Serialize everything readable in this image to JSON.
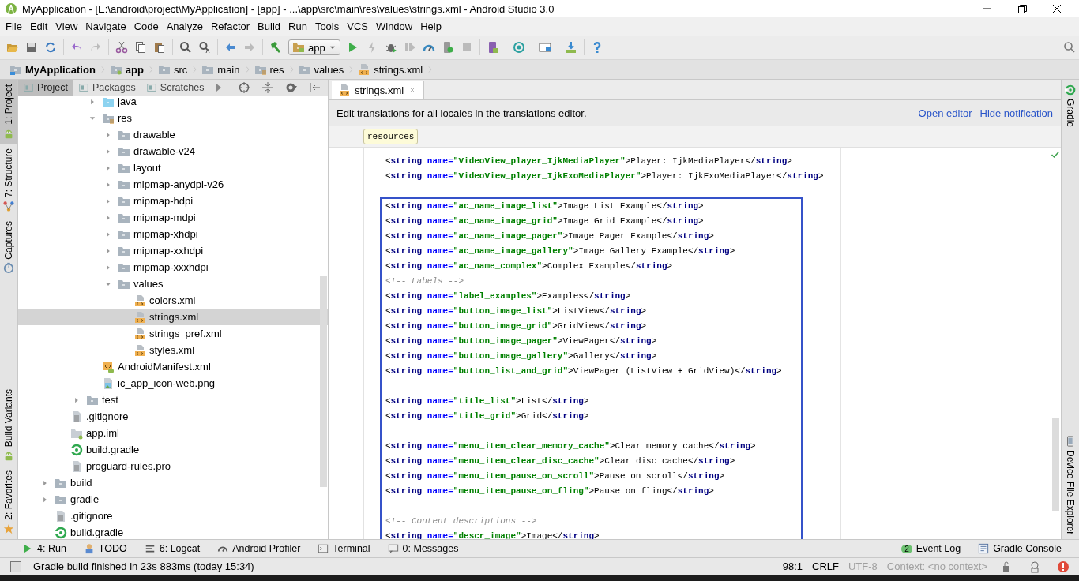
{
  "window": {
    "title": "MyApplication - [E:\\android\\project\\MyApplication] - [app] - ...\\app\\src\\main\\res\\values\\strings.xml - Android Studio 3.0"
  },
  "menu": [
    "File",
    "Edit",
    "View",
    "Navigate",
    "Code",
    "Analyze",
    "Refactor",
    "Build",
    "Run",
    "Tools",
    "VCS",
    "Window",
    "Help"
  ],
  "toolbar": {
    "run_config": "app"
  },
  "breadcrumb": [
    {
      "label": "MyApplication",
      "kind": "project"
    },
    {
      "label": "app",
      "kind": "module"
    },
    {
      "label": "src",
      "kind": "folder"
    },
    {
      "label": "main",
      "kind": "folder"
    },
    {
      "label": "res",
      "kind": "res"
    },
    {
      "label": "values",
      "kind": "folder"
    },
    {
      "label": "strings.xml",
      "kind": "xml"
    }
  ],
  "left_tabs": {
    "top": [
      {
        "label": "1: Project",
        "selected": true,
        "kind": "android"
      },
      {
        "label": "7: Structure",
        "selected": false,
        "kind": "structure"
      },
      {
        "label": "Captures",
        "selected": false,
        "kind": "camera"
      }
    ],
    "bottom": [
      {
        "label": "Build Variants",
        "selected": false,
        "kind": "android"
      },
      {
        "label": "2: Favorites",
        "selected": false,
        "kind": "star"
      }
    ]
  },
  "right_tabs": {
    "top": [
      {
        "label": "Gradle",
        "kind": "gradle"
      }
    ],
    "bottom": [
      {
        "label": "Device File Explorer",
        "kind": "phone"
      }
    ]
  },
  "project_panel": {
    "tabs": [
      {
        "label": "Project",
        "selected": true
      },
      {
        "label": "Packages",
        "selected": false
      },
      {
        "label": "Scratches",
        "selected": false
      }
    ],
    "tree": [
      {
        "children": [
          {
            "children": [
              {
                "children": [
                  {
                    "children": [
                      {
                        "label": "java",
                        "kind": "java",
                        "expanded": false,
                        "selected": false
                      },
                      {
                        "label": "res",
                        "kind": "res",
                        "expanded": true,
                        "selected": false,
                        "children": [
                          {
                            "label": "drawable",
                            "kind": "folder",
                            "expanded": false,
                            "selected": false
                          },
                          {
                            "label": "drawable-v24",
                            "kind": "folder",
                            "expanded": false,
                            "selected": false
                          },
                          {
                            "label": "layout",
                            "kind": "folder",
                            "expanded": false,
                            "selected": false
                          },
                          {
                            "label": "mipmap-anydpi-v26",
                            "kind": "folder",
                            "expanded": false,
                            "selected": false
                          },
                          {
                            "label": "mipmap-hdpi",
                            "kind": "folder",
                            "expanded": false,
                            "selected": false
                          },
                          {
                            "label": "mipmap-mdpi",
                            "kind": "folder",
                            "expanded": false,
                            "selected": false
                          },
                          {
                            "label": "mipmap-xhdpi",
                            "kind": "folder",
                            "expanded": false,
                            "selected": false
                          },
                          {
                            "label": "mipmap-xxhdpi",
                            "kind": "folder",
                            "expanded": false,
                            "selected": false
                          },
                          {
                            "label": "mipmap-xxxhdpi",
                            "kind": "folder",
                            "expanded": false,
                            "selected": false
                          },
                          {
                            "label": "values",
                            "kind": "folder",
                            "expanded": true,
                            "selected": false,
                            "children": [
                              {
                                "label": "colors.xml",
                                "kind": "xml",
                                "selected": false
                              },
                              {
                                "label": "strings.xml",
                                "kind": "xml",
                                "selected": true
                              },
                              {
                                "label": "strings_pref.xml",
                                "kind": "xml",
                                "selected": false
                              },
                              {
                                "label": "styles.xml",
                                "kind": "xml",
                                "selected": false
                              }
                            ]
                          }
                        ]
                      },
                      {
                        "label": "AndroidManifest.xml",
                        "kind": "manifest",
                        "selected": false
                      },
                      {
                        "label": "ic_app_icon-web.png",
                        "kind": "image",
                        "selected": false
                      }
                    ]
                  },
                  {
                    "label": "test",
                    "kind": "folder",
                    "expanded": false,
                    "selected": false
                  }
                ]
              },
              {
                "label": ".gitignore",
                "kind": "text",
                "selected": false
              },
              {
                "label": "app.iml",
                "kind": "iml",
                "selected": false
              },
              {
                "label": "build.gradle",
                "kind": "gradle",
                "selected": false
              },
              {
                "label": "proguard-rules.pro",
                "kind": "text",
                "selected": false
              }
            ]
          },
          {
            "label": "build",
            "kind": "folder",
            "expanded": false,
            "selected": false
          },
          {
            "label": "gradle",
            "kind": "folder",
            "expanded": false,
            "selected": false
          },
          {
            "label": ".gitignore",
            "kind": "text",
            "selected": false
          },
          {
            "label": "build.gradle",
            "kind": "gradle",
            "selected": false
          }
        ]
      }
    ]
  },
  "editor": {
    "tabs": [
      {
        "label": "strings.xml",
        "selected": true
      }
    ],
    "notification": {
      "text": "Edit translations for all locales in the translations editor.",
      "links": [
        "Open editor",
        "Hide notification"
      ]
    },
    "tag_path": "resources",
    "code_blocks": [
      {
        "framed": false,
        "lines": [
          {
            "kind": "string",
            "parts": [
              "<",
              "string",
              " name=",
              "\"VideoView_player_IjkMediaPlayer\"",
              ">Player: IjkMediaPlayer</",
              "string",
              ">"
            ]
          },
          {
            "kind": "string",
            "parts": [
              "<",
              "string",
              " name=",
              "\"VideoView_player_IjkExoMediaPlayer\"",
              ">Player: IjkExoMediaPlayer</",
              "string",
              ">"
            ]
          }
        ]
      },
      {
        "framed": true,
        "lines": [
          {
            "kind": "string",
            "parts": [
              "<",
              "string",
              " name=",
              "\"ac_name_image_list\"",
              ">Image List Example</",
              "string",
              ">"
            ]
          },
          {
            "kind": "string",
            "parts": [
              "<",
              "string",
              " name=",
              "\"ac_name_image_grid\"",
              ">Image Grid Example</",
              "string",
              ">"
            ]
          },
          {
            "kind": "string",
            "parts": [
              "<",
              "string",
              " name=",
              "\"ac_name_image_pager\"",
              ">Image Pager Example</",
              "string",
              ">"
            ]
          },
          {
            "kind": "string",
            "parts": [
              "<",
              "string",
              " name=",
              "\"ac_name_image_gallery\"",
              ">Image Gallery Example</",
              "string",
              ">"
            ]
          },
          {
            "kind": "string",
            "parts": [
              "<",
              "string",
              " name=",
              "\"ac_name_complex\"",
              ">Complex Example</",
              "string",
              ">"
            ]
          },
          {
            "kind": "comment",
            "text": "<!-- Labels -->"
          },
          {
            "kind": "string",
            "parts": [
              "<",
              "string",
              " name=",
              "\"label_examples\"",
              ">Examples</",
              "string",
              ">"
            ]
          },
          {
            "kind": "string",
            "parts": [
              "<",
              "string",
              " name=",
              "\"button_image_list\"",
              ">ListView</",
              "string",
              ">"
            ]
          },
          {
            "kind": "string",
            "parts": [
              "<",
              "string",
              " name=",
              "\"button_image_grid\"",
              ">GridView</",
              "string",
              ">"
            ]
          },
          {
            "kind": "string",
            "parts": [
              "<",
              "string",
              " name=",
              "\"button_image_pager\"",
              ">ViewPager</",
              "string",
              ">"
            ]
          },
          {
            "kind": "string",
            "parts": [
              "<",
              "string",
              " name=",
              "\"button_image_gallery\"",
              ">Gallery</",
              "string",
              ">"
            ]
          },
          {
            "kind": "string",
            "parts": [
              "<",
              "string",
              " name=",
              "\"button_list_and_grid\"",
              ">ViewPager (ListView + GridView)</",
              "string",
              ">"
            ]
          },
          {
            "kind": "blank"
          },
          {
            "kind": "string",
            "parts": [
              "<",
              "string",
              " name=",
              "\"title_list\"",
              ">List</",
              "string",
              ">"
            ]
          },
          {
            "kind": "string",
            "parts": [
              "<",
              "string",
              " name=",
              "\"title_grid\"",
              ">Grid</",
              "string",
              ">"
            ]
          },
          {
            "kind": "blank"
          },
          {
            "kind": "string",
            "parts": [
              "<",
              "string",
              " name=",
              "\"menu_item_clear_memory_cache\"",
              ">Clear memory cache</",
              "string",
              ">"
            ]
          },
          {
            "kind": "string",
            "parts": [
              "<",
              "string",
              " name=",
              "\"menu_item_clear_disc_cache\"",
              ">Clear disc cache</",
              "string",
              ">"
            ]
          },
          {
            "kind": "string",
            "parts": [
              "<",
              "string",
              " name=",
              "\"menu_item_pause_on_scroll\"",
              ">Pause on scroll</",
              "string",
              ">"
            ]
          },
          {
            "kind": "string",
            "parts": [
              "<",
              "string",
              " name=",
              "\"menu_item_pause_on_fling\"",
              ">Pause on fling</",
              "string",
              ">"
            ]
          },
          {
            "kind": "blank"
          },
          {
            "kind": "comment",
            "text": "<!-- Content descriptions -->"
          },
          {
            "kind": "string",
            "parts": [
              "<",
              "string",
              " name=",
              "\"descr_image\"",
              ">Image</",
              "string",
              ">"
            ]
          }
        ]
      }
    ]
  },
  "tool_windows": {
    "left": [
      {
        "label": "4: Run",
        "kind": "run"
      },
      {
        "label": "TODO",
        "kind": "todo"
      },
      {
        "label": "6: Logcat",
        "kind": "logcat"
      },
      {
        "label": "Android Profiler",
        "kind": "profiler"
      },
      {
        "label": "Terminal",
        "kind": "terminal"
      },
      {
        "label": "0: Messages",
        "kind": "messages"
      }
    ],
    "right": [
      {
        "label": "Event Log",
        "kind": "eventlog",
        "badge": "2"
      },
      {
        "label": "Gradle Console",
        "kind": "console"
      }
    ]
  },
  "status_bar": {
    "message": "Gradle build finished in 23s 883ms (today 15:34)",
    "position": "98:1",
    "line_separator": "CRLF",
    "encoding": "UTF-8",
    "context": "Context: <no context>"
  }
}
